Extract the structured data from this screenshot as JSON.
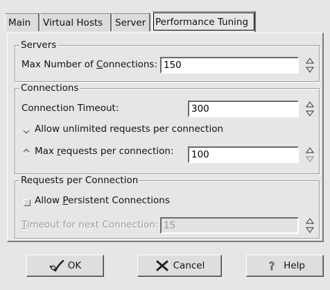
{
  "tabs": [
    {
      "label": "Main"
    },
    {
      "label": "Virtual Hosts"
    },
    {
      "label": "Server"
    },
    {
      "label": "Performance Tuning"
    }
  ],
  "servers": {
    "legend": "Servers",
    "max_connections_label_pre": "Max Number of ",
    "max_connections_label_u": "C",
    "max_connections_label_post": "onnections:",
    "max_connections_value": "150"
  },
  "connections": {
    "legend": "Connections",
    "timeout_label": "Connection Timeout:",
    "timeout_value": "300",
    "unlimited_label": "Allow unlimited requests per connection",
    "max_requests_label_pre": "Max ",
    "max_requests_label_u": "r",
    "max_requests_label_post": "equests per connection:",
    "max_requests_value": "100"
  },
  "persistence": {
    "legend": "Requests per Connection",
    "allow_label_pre": "Allow ",
    "allow_label_u": "P",
    "allow_label_post": "ersistent Connections",
    "timeout_next_label_u": "T",
    "timeout_next_label_post": "imeout for next Connection:",
    "timeout_next_value": "15"
  },
  "buttons": {
    "ok": "OK",
    "cancel": "Cancel",
    "help": "Help"
  }
}
